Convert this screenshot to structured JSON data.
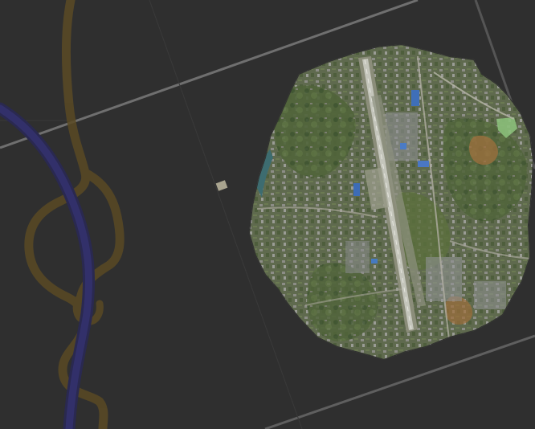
{
  "viewer": {
    "background_color": "#2f2f2f",
    "grid_line_color": "#6a6a6a",
    "tile_boundary_color": "#5a5a5a"
  },
  "layers": {
    "road_major_color": "#2b2a55",
    "road_minor_color": "#5a4a24",
    "imagery_tone": "#5d6c48",
    "runway_color": "#b9b9b0",
    "water_color": "#3d6c70"
  },
  "features": [
    {
      "kind": "airport-runway"
    },
    {
      "kind": "orthophoto-mosaic"
    },
    {
      "kind": "marker"
    }
  ]
}
